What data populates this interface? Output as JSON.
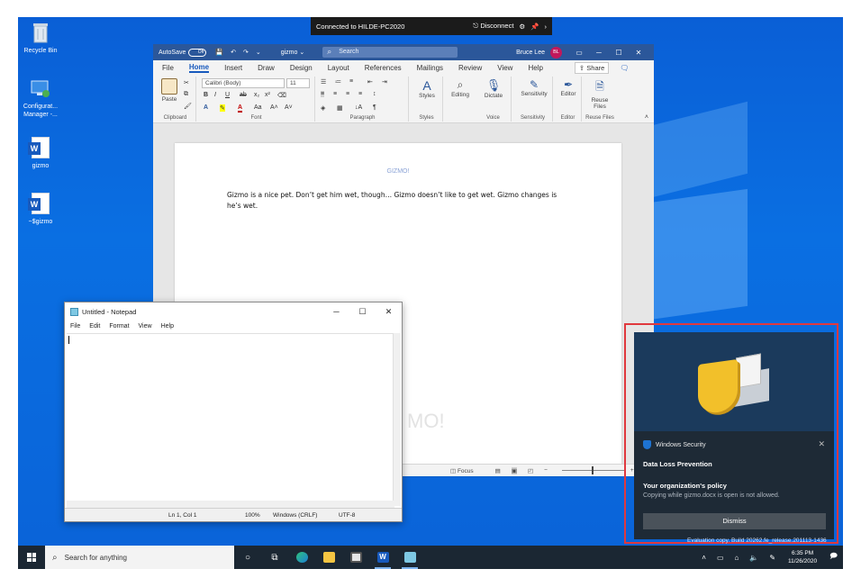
{
  "rdp": {
    "title": "Connected to HILDE-PC2020",
    "disconnect": "Disconnect",
    "settings_icon": "gear-icon",
    "pin_icon": "pin-icon"
  },
  "desktop": {
    "icons": [
      {
        "label": "Recycle Bin",
        "icon": "recycle-bin-icon"
      },
      {
        "label": "Configurat... Manager -...",
        "icon": "configuration-manager-icon"
      },
      {
        "label": "gizmo",
        "icon": "word-document-icon"
      },
      {
        "label": "~$gizmo",
        "icon": "word-document-icon"
      }
    ]
  },
  "word": {
    "autosave_label": "AutoSave",
    "autosave_state": "Off",
    "doc_name": "gizmo",
    "search_placeholder": "Search",
    "user_name": "Bruce Lee",
    "user_initials": "BL",
    "tabs": [
      "File",
      "Home",
      "Insert",
      "Draw",
      "Design",
      "Layout",
      "References",
      "Mailings",
      "Review",
      "View",
      "Help"
    ],
    "active_tab": "Home",
    "share_label": "Share",
    "ribbon": {
      "paste": "Paste",
      "font_name": "Calibri (Body)",
      "font_size": "11",
      "styles": "Styles",
      "editing": "Editing",
      "dictate": "Dictate",
      "sensitivity": "Sensitivity",
      "editor": "Editor",
      "reuse_files": "Reuse Files",
      "groups": [
        "Clipboard",
        "Font",
        "Paragraph",
        "Styles",
        "Voice",
        "Sensitivity",
        "Editor",
        "Reuse Files"
      ]
    },
    "document": {
      "header": "GIZMO!",
      "body": "Gizmo is a nice pet.  Don’t get him wet, though… Gizmo doesn’t like to get wet.  Gizmo changes is he’s wet.",
      "watermark": "MO!"
    },
    "status": {
      "focus": "Focus",
      "zoom_fraction": 0.47
    }
  },
  "notepad": {
    "title": "Untitled - Notepad",
    "menu": [
      "File",
      "Edit",
      "Format",
      "View",
      "Help"
    ],
    "status": {
      "position": "Ln 1, Col 1",
      "zoom": "100%",
      "line_ending": "Windows (CRLF)",
      "encoding": "UTF-8"
    }
  },
  "toast": {
    "app_name": "Windows Security",
    "title": "Data Loss Prevention",
    "subtitle": "Your organization's policy",
    "message": "Copying while gizmo.docx is open is not allowed.",
    "dismiss_label": "Dismiss",
    "highlight_color": "#e0393e"
  },
  "evaluation_text": "Evaluation copy. Build 20262.fe_release.201113-1436",
  "taskbar": {
    "search_placeholder": "Search for anything",
    "time": "6:35 PM",
    "date": "11/26/2020",
    "pinned": [
      "task-view-icon",
      "edge-icon",
      "file-explorer-icon",
      "store-icon",
      "word-icon",
      "notepad-icon"
    ]
  }
}
